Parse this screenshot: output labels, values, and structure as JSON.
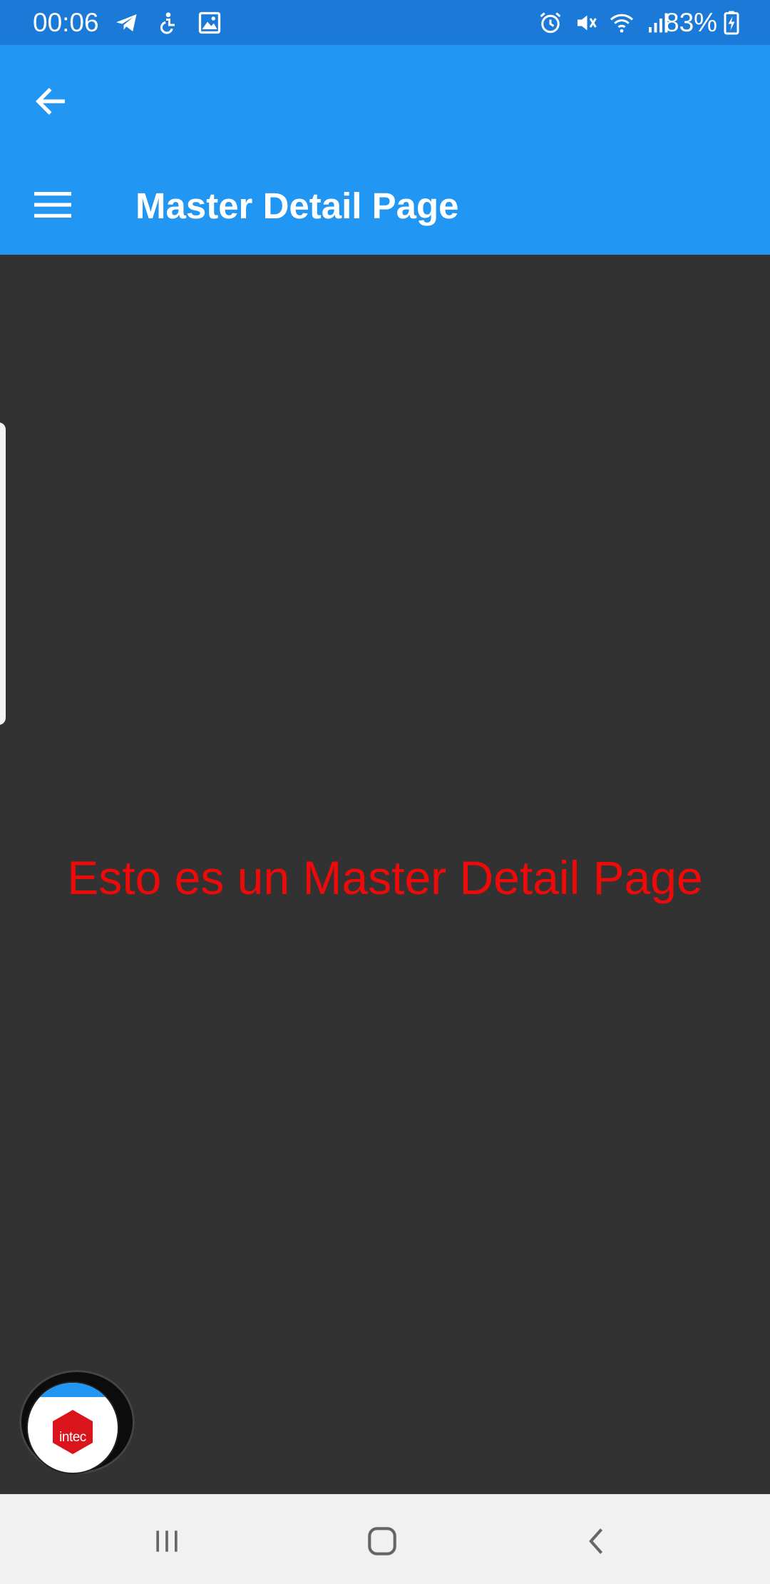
{
  "status_bar": {
    "time": "00:06",
    "battery_percent": "83%",
    "left_icons": [
      "telegram-icon",
      "accessibility-icon",
      "gallery-icon"
    ],
    "right_icons": [
      "alarm-icon",
      "vibrate-mute-icon",
      "wifi-icon",
      "signal-icon",
      "battery-charging-icon"
    ]
  },
  "app_bar": {
    "title": "Master Detail Page",
    "back_icon": "arrow-back-icon",
    "menu_icon": "hamburger-menu-icon",
    "color": "#2196f3"
  },
  "content": {
    "message": "Esto es un Master Detail Page",
    "message_color": "#ef0a0a",
    "background": "#323232"
  },
  "floating_bubble": {
    "logo_text": "intec",
    "logo_color": "#d9141b"
  },
  "nav_bar": {
    "buttons": [
      "recents-icon",
      "home-icon",
      "back-icon"
    ]
  }
}
